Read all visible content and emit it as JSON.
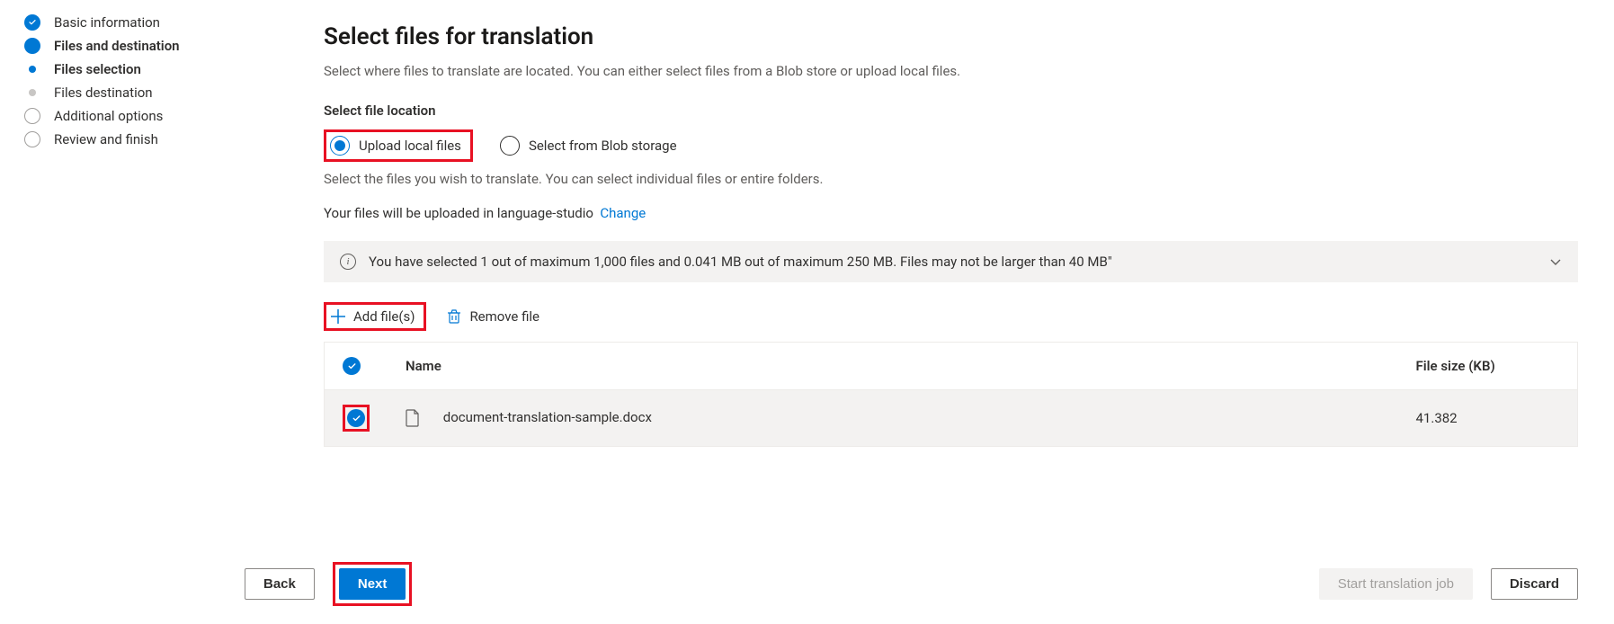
{
  "wizard": {
    "steps": [
      {
        "label": "Basic information",
        "state": "done"
      },
      {
        "label": "Files and destination",
        "state": "current"
      },
      {
        "label": "Files selection",
        "state": "sub-current"
      },
      {
        "label": "Files destination",
        "state": "sub-pending"
      },
      {
        "label": "Additional options",
        "state": "pending"
      },
      {
        "label": "Review and finish",
        "state": "pending"
      }
    ]
  },
  "main": {
    "title": "Select files for translation",
    "subtitle": "Select where files to translate are located. You can either select files from a Blob store or upload local files.",
    "select_location_label": "Select file location",
    "radio": {
      "upload_local": "Upload local files",
      "blob_storage": "Select from Blob storage"
    },
    "helper": "Select the files you wish to translate. You can select individual files or entire folders.",
    "upload_line_prefix": "Your files will be uploaded in language-studio",
    "change_link": "Change",
    "info_text": "You have selected 1 out of maximum 1,000 files and 0.041 MB out of maximum 250 MB. Files may not be larger than 40 MB\"",
    "toolbar": {
      "add_files": "Add file(s)",
      "remove_file": "Remove file"
    },
    "table": {
      "col_name": "Name",
      "col_size": "File size (KB)",
      "rows": [
        {
          "name": "document-translation-sample.docx",
          "size": "41.382"
        }
      ]
    }
  },
  "footer": {
    "back": "Back",
    "next": "Next",
    "start_job": "Start translation job",
    "discard": "Discard"
  }
}
